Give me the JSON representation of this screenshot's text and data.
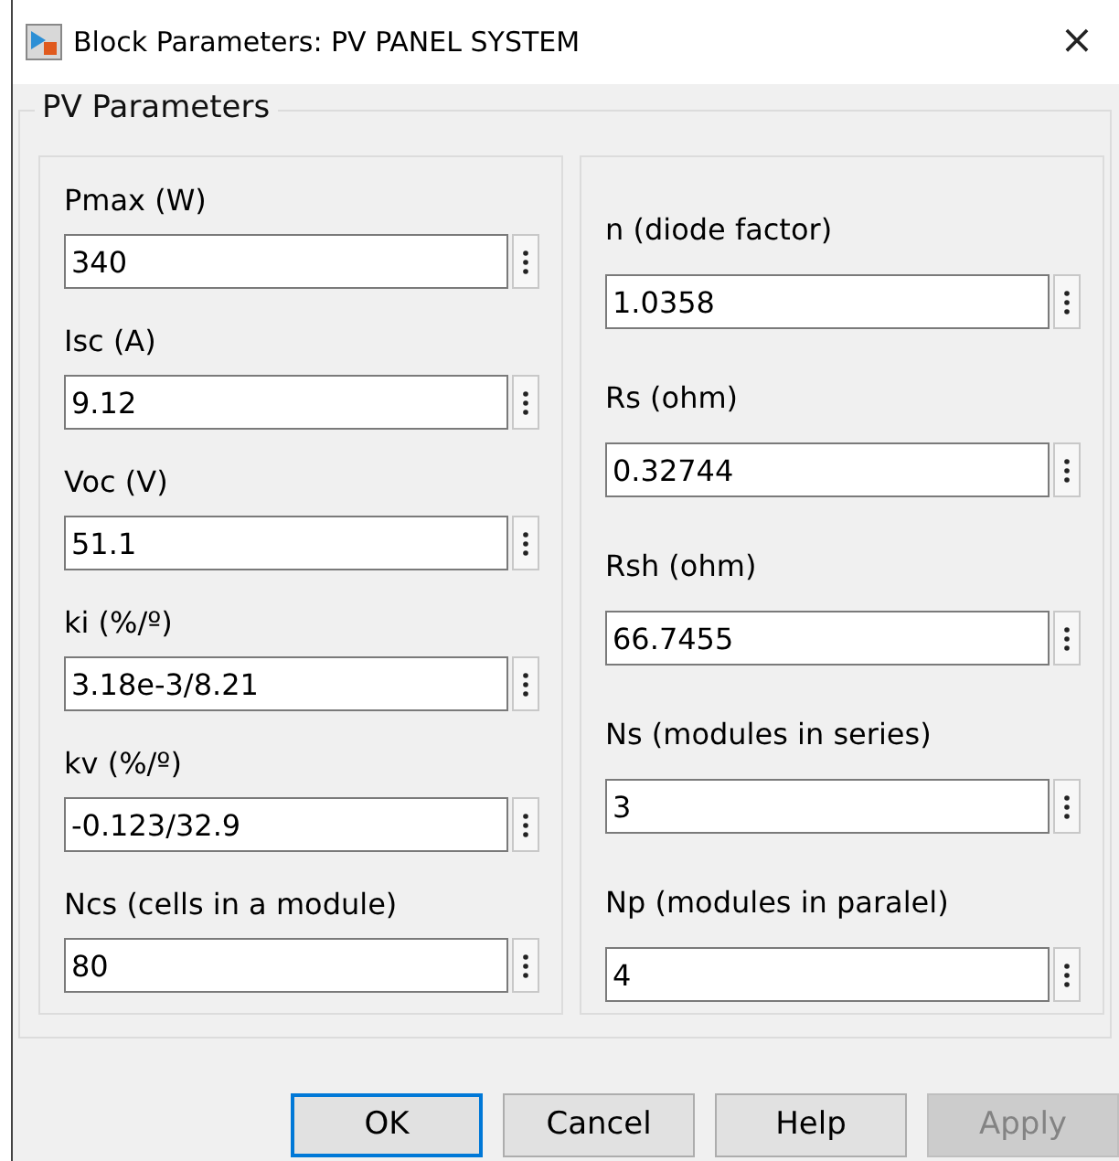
{
  "window": {
    "title": "Block Parameters: PV PANEL SYSTEM",
    "close": "×"
  },
  "group": {
    "title": "PV Parameters",
    "columns": [
      {
        "parameters": [
          {
            "label": "Pmax (W)",
            "value": "340"
          },
          {
            "label": "Isc (A)",
            "value": "9.12"
          },
          {
            "label": "Voc (V)",
            "value": "51.1"
          },
          {
            "label": "ki (%/º)",
            "value": "3.18e-3/8.21"
          },
          {
            "label": "kv (%/º)",
            "value": "-0.123/32.9"
          },
          {
            "label": "Ncs (cells in a module)",
            "value": "80"
          }
        ]
      },
      {
        "parameters": [
          {
            "label": "n (diode factor)",
            "value": "1.0358"
          },
          {
            "label": "Rs (ohm)",
            "value": "0.32744"
          },
          {
            "label": "Rsh (ohm)",
            "value": "66.7455"
          },
          {
            "label": "Ns (modules in series)",
            "value": "3"
          },
          {
            "label": "Np (modules in paralel)",
            "value": "4"
          }
        ]
      }
    ]
  },
  "buttons": [
    {
      "label": "OK",
      "default": true,
      "disabled": false
    },
    {
      "label": "Cancel",
      "default": false,
      "disabled": false
    },
    {
      "label": "Help",
      "default": false,
      "disabled": false
    },
    {
      "label": "Apply",
      "default": false,
      "disabled": true
    }
  ]
}
